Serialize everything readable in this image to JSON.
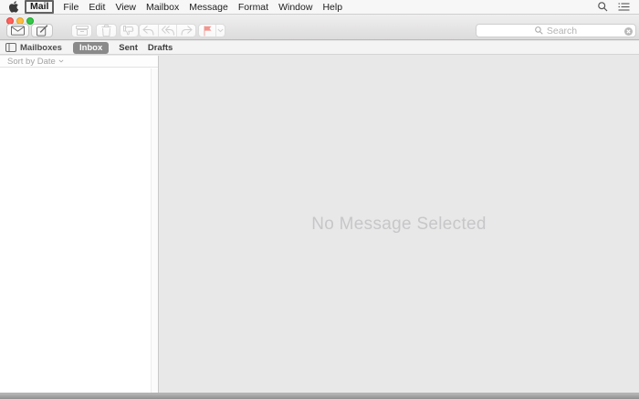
{
  "app": {
    "name": "Mail"
  },
  "menu_bar": {
    "items": [
      {
        "label": "Mail",
        "highlighted": true
      },
      {
        "label": "File",
        "highlighted": false
      },
      {
        "label": "Edit",
        "highlighted": false
      },
      {
        "label": "View",
        "highlighted": false
      },
      {
        "label": "Mailbox",
        "highlighted": false
      },
      {
        "label": "Message",
        "highlighted": false
      },
      {
        "label": "Format",
        "highlighted": false
      },
      {
        "label": "Window",
        "highlighted": false
      },
      {
        "label": "Help",
        "highlighted": false
      }
    ],
    "right_icons": [
      "spotlight-search-icon",
      "notification-center-icon"
    ]
  },
  "window_controls": [
    "close",
    "minimize",
    "zoom"
  ],
  "toolbar": {
    "buttons": [
      {
        "id": "get-mail",
        "icon": "envelope-icon",
        "enabled": true
      },
      {
        "id": "compose",
        "icon": "compose-icon",
        "enabled": true
      },
      {
        "id": "archive",
        "icon": "archive-icon",
        "enabled": false
      },
      {
        "id": "trash",
        "icon": "trash-icon",
        "enabled": false
      },
      {
        "id": "junk",
        "icon": "thumbs-down-icon",
        "enabled": false
      },
      {
        "id": "reply",
        "icon": "reply-icon",
        "enabled": false
      },
      {
        "id": "reply-all",
        "icon": "reply-all-icon",
        "enabled": false
      },
      {
        "id": "forward",
        "icon": "forward-icon",
        "enabled": false
      },
      {
        "id": "flag",
        "icon": "flag-icon",
        "enabled": false
      }
    ],
    "search": {
      "placeholder": "Search"
    }
  },
  "favorites_bar": {
    "mailboxes_label": "Mailboxes",
    "items": [
      {
        "label": "Inbox",
        "selected": true
      },
      {
        "label": "Sent",
        "selected": false
      },
      {
        "label": "Drafts",
        "selected": false
      }
    ]
  },
  "message_list": {
    "sort_label": "Sort by Date",
    "messages": []
  },
  "main": {
    "empty_text": "No Message Selected"
  },
  "colors": {
    "flag": "#f2948d",
    "selected_pill": "#8a8a8a",
    "traffic_close": "#fc615c",
    "traffic_minimize": "#fdbc40",
    "traffic_zoom": "#34c748",
    "main_background": "#e8e8e8",
    "empty_text": "#c7c7ca"
  }
}
